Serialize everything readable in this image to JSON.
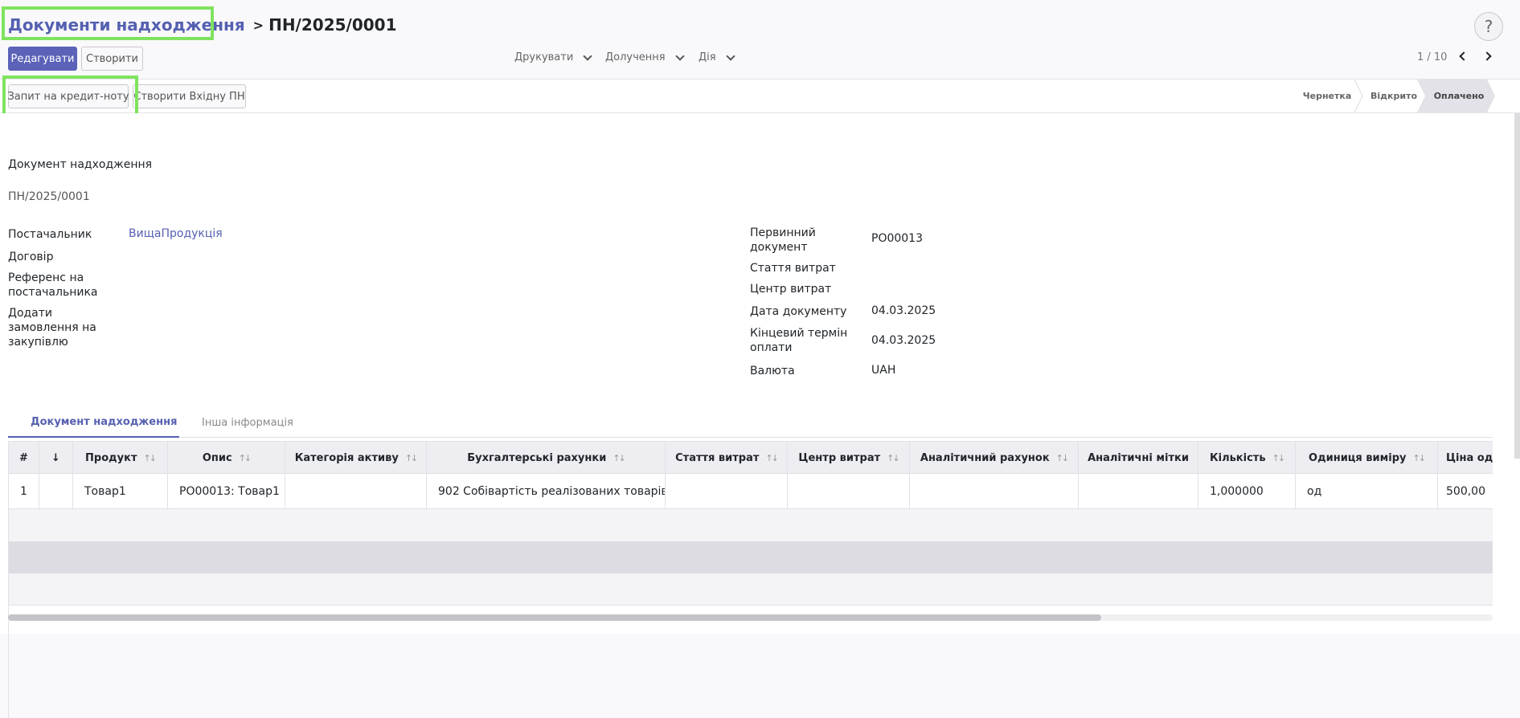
{
  "breadcrumb": {
    "parent": "Документи надходження",
    "separator": ">",
    "current": "ПН/2025/0001"
  },
  "help": {
    "label": "?"
  },
  "toolbar": {
    "edit_label": "Редагувати",
    "create_label": "Створити",
    "print_label": "Друкувати",
    "attachments_label": "Долучення",
    "action_label": "Дія"
  },
  "pager": {
    "value": "1 / 10"
  },
  "statusbar": {
    "buttons": {
      "credit_note": "Запит на кредит-ноту",
      "create_incoming": "Створити Вхідну ПН"
    },
    "stages": [
      "Чернетка",
      "Відкрито",
      "Оплачено"
    ],
    "active_stage": "Оплачено"
  },
  "form": {
    "doc_type": "Документ надходження",
    "doc_number": "ПН/2025/0001",
    "left": {
      "vendor_label": "Постачальник",
      "vendor_value": "ВищаПродукція",
      "contract_label": "Договір",
      "vendor_ref_label": "Референс на постачальника",
      "add_po_label": "Додати замовлення на закупівлю"
    },
    "right": {
      "source_doc_label": "Первинний документ",
      "source_doc_value": "PO00013",
      "expense_item_label": "Стаття витрат",
      "cost_center_label": "Центр витрат",
      "doc_date_label": "Дата документу",
      "doc_date_value": "04.03.2025",
      "due_date_label": "Кінцевий термін оплати",
      "due_date_value": "04.03.2025",
      "currency_label": "Валюта",
      "currency_value": "UAH"
    }
  },
  "tabs": [
    "Документ надходження",
    "Інша інформація"
  ],
  "table": {
    "columns": [
      "#",
      "↓",
      "Продукт",
      "Опис",
      "Категорія активу",
      "Бухгалтерські рахунки",
      "Стаття витрат",
      "Центр витрат",
      "Аналітичний рахунок",
      "Аналітичні мітки",
      "Кількість",
      "Одиниця виміру",
      "Ціна од"
    ],
    "rows": [
      [
        "1",
        "",
        "Товар1",
        "PO00013: Товар1",
        "",
        "902 Собівартість реалізованих товарів",
        "",
        "",
        "",
        "",
        "1,000000",
        "од",
        "500,00"
      ]
    ]
  },
  "colors": {
    "accent": "#5560b0",
    "primary_button": "#5b62b8",
    "highlight": "#7fe35f"
  }
}
